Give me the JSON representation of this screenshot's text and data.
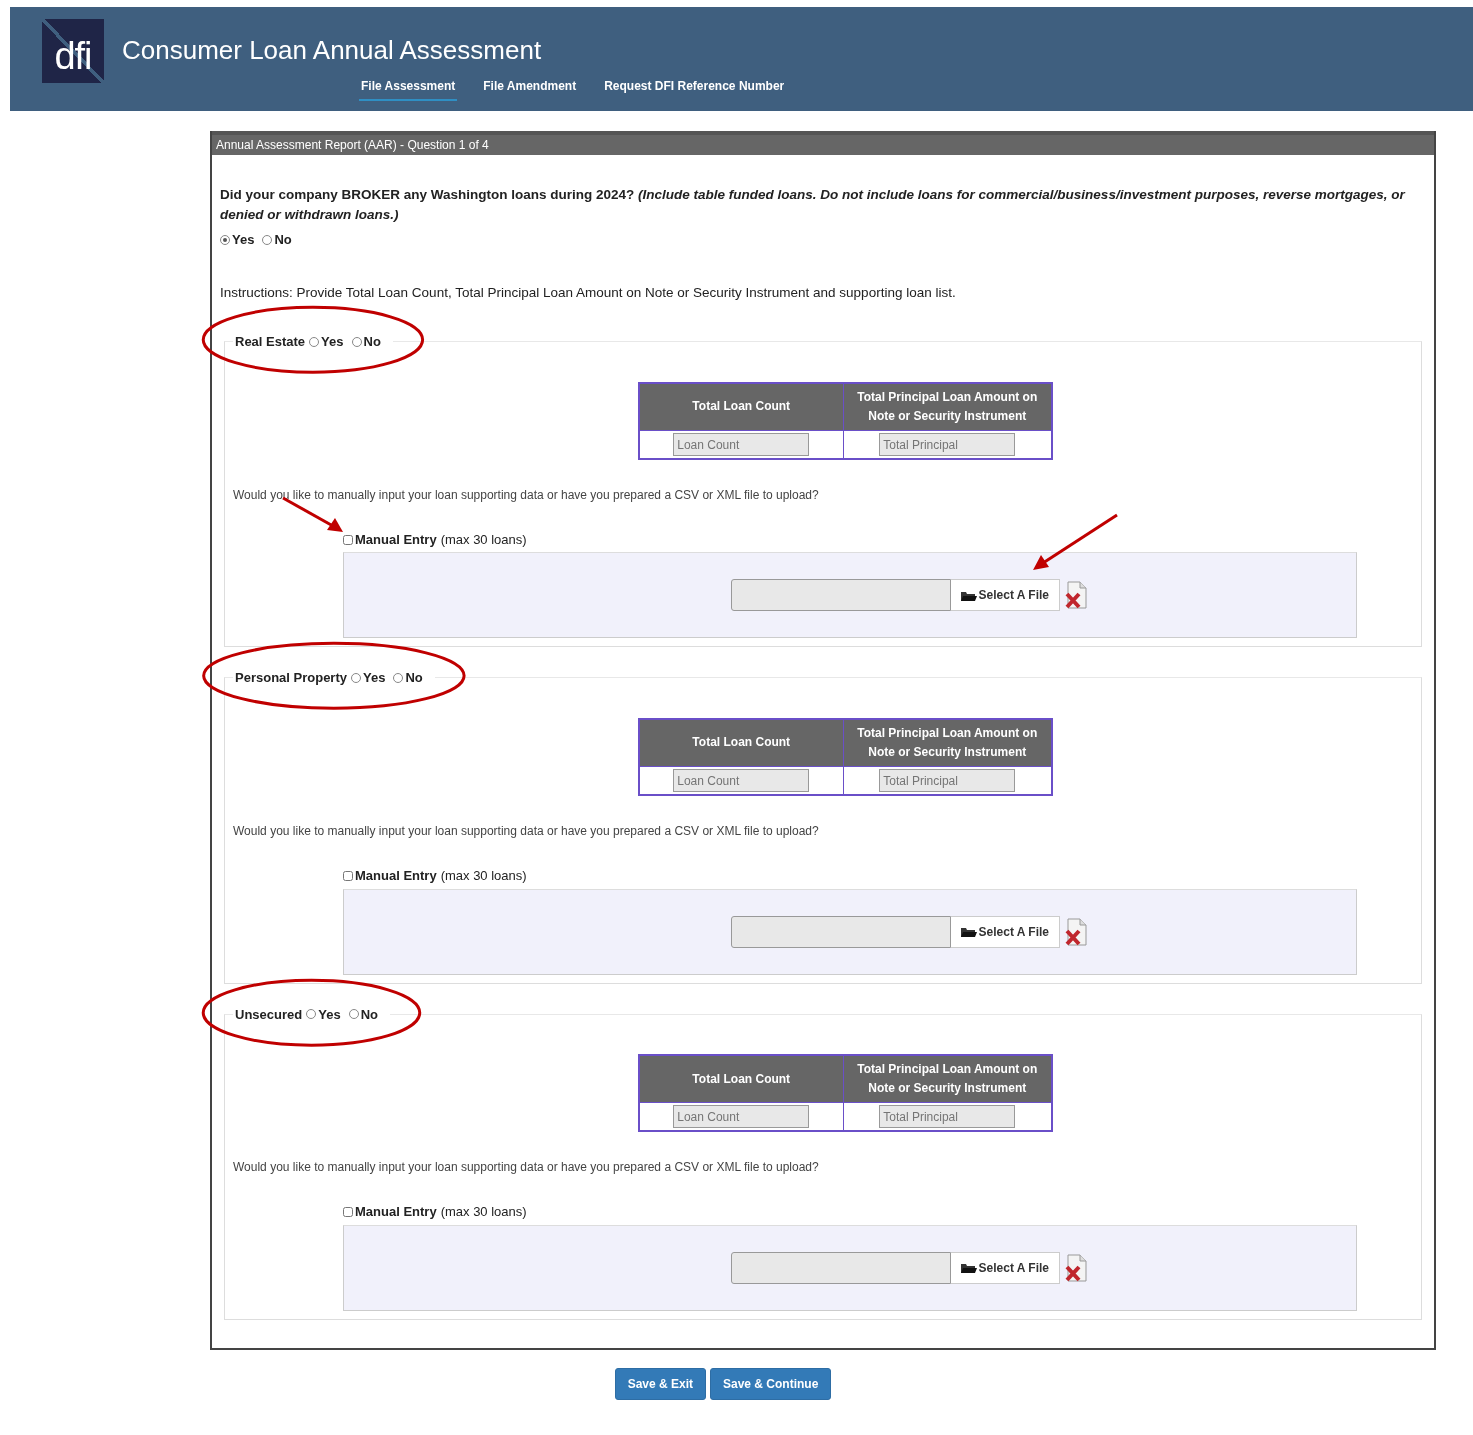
{
  "header": {
    "logo": "dfi",
    "title": "Consumer Loan Annual Assessment",
    "nav": [
      {
        "label": "File Assessment",
        "selected": true
      },
      {
        "label": "File Amendment",
        "selected": false
      },
      {
        "label": "Request DFI Reference Number",
        "selected": false
      }
    ]
  },
  "form": {
    "legend": "Annual Assessment Report (AAR) - Question 1 of 4",
    "question": "Did your company BROKER any Washington loans during 2024? *(Include table funded loans. Do not include loans for commercial/business/investment purposes, reverse mortgages, or denied or withdrawn loans.)*",
    "answers": [
      {
        "label": "Yes",
        "selected": true
      },
      {
        "label": "No",
        "selected": false
      }
    ],
    "instructions": "Instructions: Provide Total Loan Count, Total Principal Loan Amount on Note or Security Instrument and supporting loan list.",
    "sections": [
      {
        "title": "Real Estate",
        "options": [
          {
            "label": "Yes",
            "selected": false
          },
          {
            "label": "No",
            "selected": false
          }
        ],
        "columns": [
          "Total Loan Count",
          "Total Principal Loan Amount on Note or Security Instrument"
        ],
        "placeholders": [
          "Loan Count",
          "Total Principal"
        ],
        "prompt": "Would you like to manually input your loan supporting data or have you prepared a CSV or XML file to upload?",
        "manual_entry": {
          "label": "Manual Entry",
          "note": "(max 30 loans)",
          "checked": false
        },
        "file_button": "Select A File",
        "circled": true,
        "arrows": true
      },
      {
        "title": "Personal Property",
        "options": [
          {
            "label": "Yes",
            "selected": false
          },
          {
            "label": "No",
            "selected": false
          }
        ],
        "columns": [
          "Total Loan Count",
          "Total Principal Loan Amount on Note or Security Instrument"
        ],
        "placeholders": [
          "Loan Count",
          "Total Principal"
        ],
        "prompt": "Would you like to manually input your loan supporting data or have you prepared a CSV or XML file to upload?",
        "manual_entry": {
          "label": "Manual Entry",
          "note": "(max 30 loans)",
          "checked": false
        },
        "file_button": "Select A File",
        "circled": true,
        "arrows": false
      },
      {
        "title": "Unsecured",
        "options": [
          {
            "label": "Yes",
            "selected": false
          },
          {
            "label": "No",
            "selected": false
          }
        ],
        "columns": [
          "Total Loan Count",
          "Total Principal Loan Amount on Note or Security Instrument"
        ],
        "placeholders": [
          "Loan Count",
          "Total Principal"
        ],
        "prompt": "Would you like to manually input your loan supporting data or have you prepared a CSV or XML file to upload?",
        "manual_entry": {
          "label": "Manual Entry",
          "note": "(max 30 loans)",
          "checked": false
        },
        "file_button": "Select A File",
        "circled": true,
        "arrows": false
      }
    ]
  },
  "buttons": [
    "Save & Exit",
    "Save & Continue"
  ]
}
